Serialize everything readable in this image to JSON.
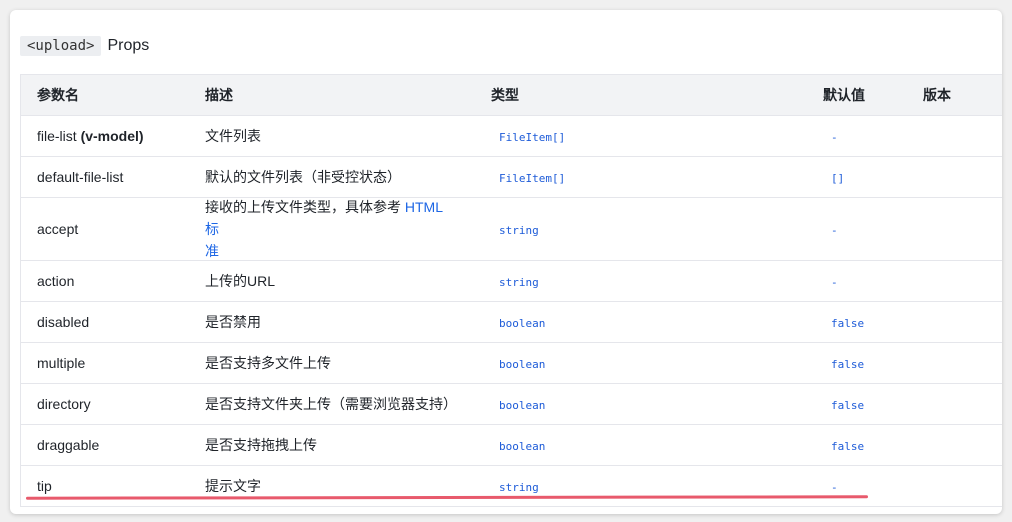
{
  "heading": {
    "tag": "<upload>",
    "title": "Props"
  },
  "table": {
    "headers": [
      "参数名",
      "描述",
      "类型",
      "默认值",
      "版本"
    ],
    "rows": [
      {
        "name": "file-list",
        "name_suffix": "(v-model)",
        "desc": "文件列表",
        "desc_link": "",
        "desc_tail": "",
        "type": "FileItem[]",
        "default": "-"
      },
      {
        "name": "default-file-list",
        "name_suffix": "",
        "desc": "默认的文件列表（非受控状态）",
        "desc_link": "",
        "desc_tail": "",
        "type": "FileItem[]",
        "default": "[]"
      },
      {
        "name": "accept",
        "name_suffix": "",
        "desc": "接收的上传文件类型，具体参考 ",
        "desc_link": "HTML标",
        "desc_tail": "准",
        "type": "string",
        "default": "-"
      },
      {
        "name": "action",
        "name_suffix": "",
        "desc": "上传的URL",
        "desc_link": "",
        "desc_tail": "",
        "type": "string",
        "default": "-"
      },
      {
        "name": "disabled",
        "name_suffix": "",
        "desc": "是否禁用",
        "desc_link": "",
        "desc_tail": "",
        "type": "boolean",
        "default": "false"
      },
      {
        "name": "multiple",
        "name_suffix": "",
        "desc": "是否支持多文件上传",
        "desc_link": "",
        "desc_tail": "",
        "type": "boolean",
        "default": "false"
      },
      {
        "name": "directory",
        "name_suffix": "",
        "desc": "是否支持文件夹上传（需要浏览器支持）",
        "desc_link": "",
        "desc_tail": "",
        "type": "boolean",
        "default": "false"
      },
      {
        "name": "draggable",
        "name_suffix": "",
        "desc": "是否支持拖拽上传",
        "desc_link": "",
        "desc_tail": "",
        "type": "boolean",
        "default": "false"
      },
      {
        "name": "tip",
        "name_suffix": "",
        "desc": "提示文字",
        "desc_link": "",
        "desc_tail": "",
        "type": "string",
        "default": "-"
      }
    ]
  },
  "colors": {
    "code": "#1d5bd8",
    "link": "#1d66e5",
    "annotation_underline": "#e85a6c",
    "header_bg": "#f2f3f5"
  }
}
